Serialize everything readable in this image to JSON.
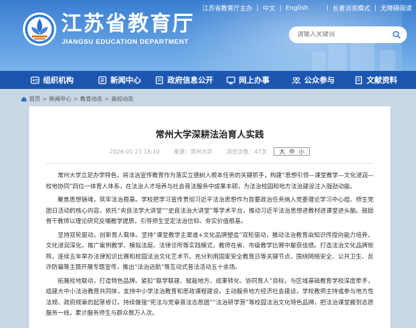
{
  "top_links": {
    "app": "江苏省教育厅主办",
    "lang_cn": "中文",
    "lang_en": "English",
    "elder_mode": "长者浏览模式",
    "accessible": "无障碍阅读"
  },
  "header": {
    "title": "江苏省教育厅",
    "subtitle": "JIANGSU EDUCATION DEPARTMENT",
    "search_placeholder": "请输入关键词"
  },
  "nav": {
    "items": [
      {
        "label": "组织机构",
        "icon": "org-icon"
      },
      {
        "label": "新闻中心",
        "icon": "news-icon"
      },
      {
        "label": "政府信息公开",
        "icon": "gov-info-icon"
      },
      {
        "label": "网上办事",
        "icon": "online-service-icon"
      },
      {
        "label": "公众参与",
        "icon": "public-icon"
      },
      {
        "label": "文献资料",
        "icon": "docs-icon"
      }
    ]
  },
  "breadcrumb": {
    "items": [
      "首页",
      "新闻中心",
      "教育动态",
      "高校动态"
    ]
  },
  "article": {
    "title": "常州大学深耕法治育人实践",
    "date": "2026-01-23 18:10",
    "source": "来源：常州大学",
    "views": "浏览次数：47次",
    "font_sizes": [
      "大",
      "中",
      "小"
    ],
    "paragraphs": [
      "常州大学立足办学特色，将法治宣传教育作为落实立德树人根本任务的关键抓手，构建“思想引领—课堂教学—文化浸润—校地协同”四位一体育人体系，在法治人才培养与社会普法服务中成果丰硕，为法治校园和地方法治建设注入强劲动能。",
      "聚焦思想铸魂，筑牢法治根基。学校把学习宣传贯彻习近平法治思想作为首要政治任务纳入党委理论学习中心组、师生党团日活动的核心内容，依托“央良法学大讲堂”“史良法治大讲堂”等学术平台，推动习近平法治思想进教材进课堂进头脑。鼓励骨干教师以理论研究反哺教学提质，引导师生坚定法治信仰、夯实价值根基。",
      "坚持双轮驱动，创新育人载体。坚持“课堂教学主渠道+文化品牌塑造”双轮驱动，推动法治教育由知识传授向能力培养、文化浸润深化。推广案例教学、模拟法庭、法律诊所等实践模式，教师在省、市级教学比赛中屡获佳绩。打造法治文化品牌矩阵，连续五年举办法律知识比赛和校园法治文化艺术节。充分利用国家安全教育日等关键节点，围绕网络安全、公共卫生、反诈防骗等主题开展专题宣传，推出“法治远航”等互动式普法活动五十余场。",
      "拓展校地联动，打造特色品牌。紧扣“联学联建、赋能地方、成果转化、协同育人”目标，与区域基础教育学校深度牵手，组建大中小法治教育共同体，支持中小学法治教育和思政课程建设。主动服务地方经济社会建设，学校教师主持或参与地方性法规、政府规章的起草修订。持续做强“宪法与党章普法志愿团”“法治研学营”等校园法治文化特色品牌，把法治课堂搬到志愿服务一线，累计服务师生与群众数万人次。"
    ]
  },
  "colors": {
    "nav_bg": "#1c56b0",
    "header_top": "#3a7ed0",
    "page_bg": "#c9d6e4"
  }
}
